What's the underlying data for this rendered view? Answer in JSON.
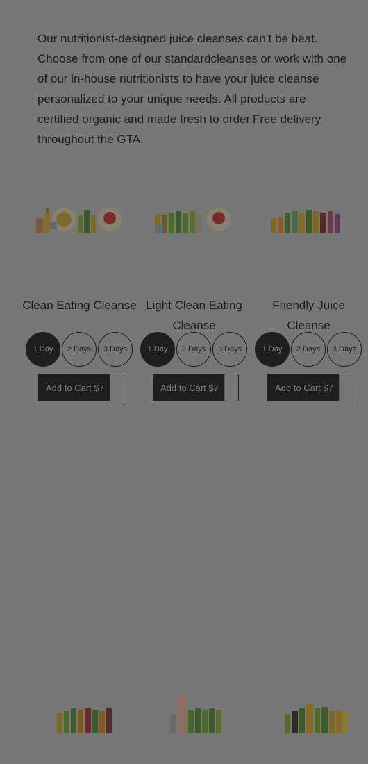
{
  "intro": {
    "text": "Our nutritionist-designed juice cleanses can’t be beat. Choose from one of our standardcleanses or work with one of our in-house nutritionists to have your juice cleanse personalized to your unique needs. All products are certified organic and made fresh to order.Free delivery throughout the GTA."
  },
  "products": [
    {
      "name": "Clean Eating Cleanse",
      "options": [
        "1 Day",
        "2 Days",
        "3 Days"
      ],
      "selected": "1 Day",
      "cart_label": "Add to Cart $7"
    },
    {
      "name": "Light Clean Eating Cleanse",
      "options": [
        "1 Day",
        "2 Days",
        "3 Days"
      ],
      "selected": "1 Day",
      "cart_label": "Add to Cart $7"
    },
    {
      "name": "Friendly Juice Cleanse",
      "options": [
        "1 Day",
        "2 Days",
        "3 Days"
      ],
      "selected": "1 Day",
      "cart_label": "Add to Cart $7"
    }
  ],
  "colors": {
    "overlay_bg": "#777777",
    "dark": "#1e1e1e"
  }
}
